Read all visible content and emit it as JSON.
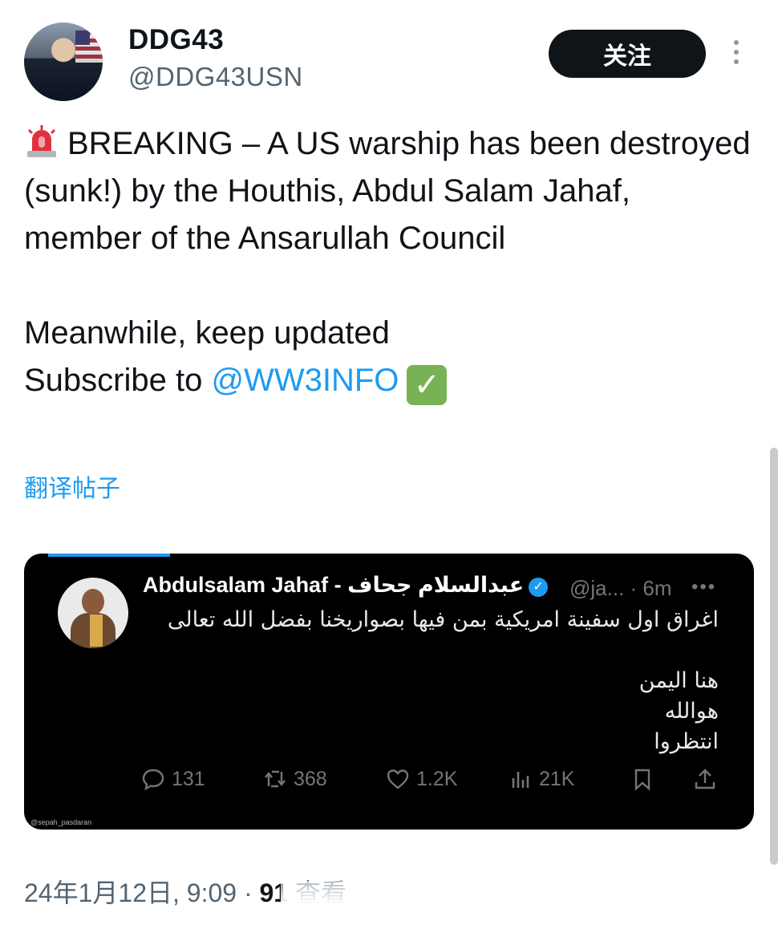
{
  "author": {
    "display_name": "DDG43",
    "handle": "@DDG43USN",
    "follow_label": "关注"
  },
  "tweet": {
    "lines": [
      "BREAKING – A US warship has been destroyed (sunk!) by the Houthis, Abdul Salam Jahaf, member of the Ansarullah Council",
      "Meanwhile, keep updated"
    ],
    "subscribe_prefix": "Subscribe to ",
    "mention": "@WW3INFO",
    "translate_label": "翻译帖子"
  },
  "embedded": {
    "name": "Abdulsalam Jahaf - عبدالسلام جحاف",
    "handle_time": "@ja... · 6m",
    "more": "•••",
    "text_lines": [
      "اغراق اول سفينة امريكية بمن فيها بصواريخنا بفضل الله تعالى",
      "",
      "هنا اليمن",
      "هوالله",
      "انتظروا"
    ],
    "stats": {
      "replies": "131",
      "retweets": "368",
      "likes": "1.2K",
      "views": "21K"
    },
    "watermark": "@sepah_pasdaran"
  },
  "footer": {
    "datetime": "24年1月12日, 9:09",
    "separator": " · ",
    "views_count": "91",
    "views_label": " 查看"
  },
  "colors": {
    "link": "#1d9bf0",
    "secondary": "#536471",
    "button_bg": "#0f1419"
  }
}
